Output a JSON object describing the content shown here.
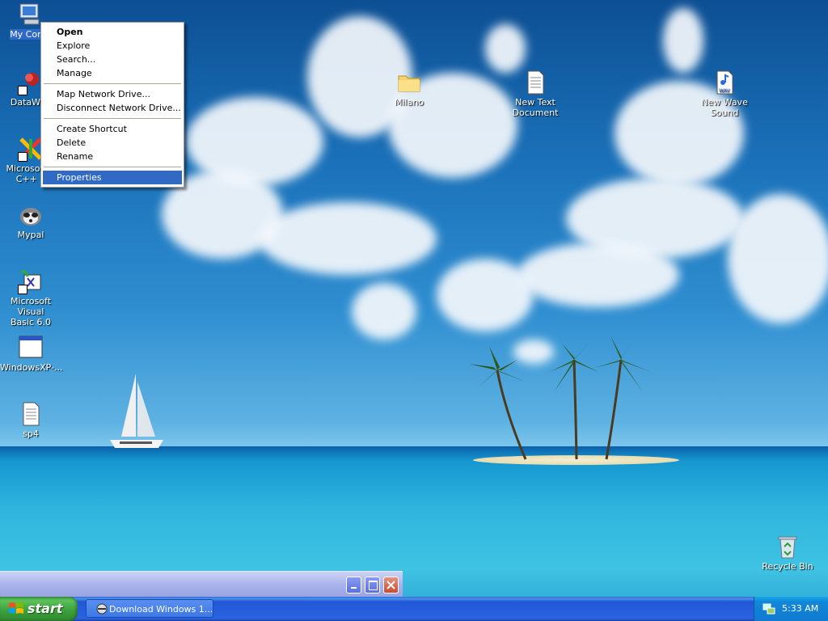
{
  "desktop": {
    "icons_left": [
      {
        "label": "My Comp",
        "icon": "my-computer-icon"
      },
      {
        "label": "DataWag",
        "icon": "datawag-icon"
      },
      {
        "label": "Microsoft V\nC++ 6",
        "icon": "visual-cpp-icon"
      },
      {
        "label": "Mypal",
        "icon": "mypal-icon"
      },
      {
        "label": "Microsoft Visual\nBasic 6.0",
        "icon": "visual-basic-icon"
      },
      {
        "label": "WindowsXP-...",
        "icon": "window-icon"
      },
      {
        "label": "sp4",
        "icon": "text-document-icon"
      }
    ],
    "icons_right": [
      {
        "label": "Milano",
        "icon": "folder-icon"
      },
      {
        "label": "New Text\nDocument",
        "icon": "text-document-icon"
      },
      {
        "label": "New Wave\nSound",
        "icon": "wave-sound-icon"
      },
      {
        "label": "Recycle Bin",
        "icon": "recycle-bin-icon"
      }
    ]
  },
  "context_menu": {
    "items": [
      "Open",
      "Explore",
      "Search...",
      "Manage",
      "Map Network Drive...",
      "Disconnect Network Drive...",
      "Create Shortcut",
      "Delete",
      "Rename",
      "Properties"
    ],
    "default_item": "Open",
    "highlighted_item": "Properties"
  },
  "minimized_window": {
    "buttons": [
      "minimize-icon",
      "maximize-icon",
      "close-icon"
    ]
  },
  "taskbar": {
    "start_label": "start",
    "tasks": [
      {
        "label": "Download Windows 1...",
        "icon": "browser-icon"
      }
    ],
    "clock": "5:33 AM",
    "tray_icons": [
      "network-icon"
    ]
  },
  "colors": {
    "taskbar_blue": "#2a63e0",
    "start_green": "#3a9e3a",
    "selection_blue": "#316ac5",
    "close_red": "#d8604a"
  }
}
